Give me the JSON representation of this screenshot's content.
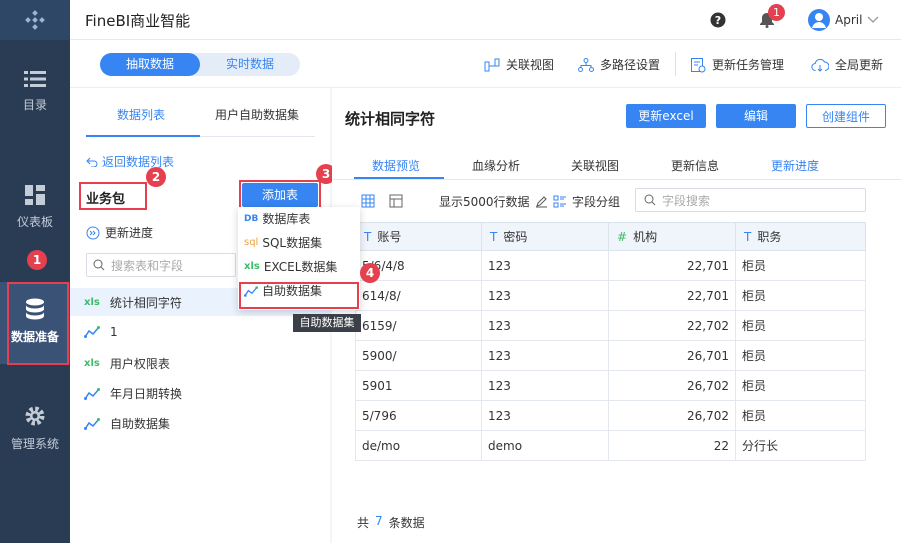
{
  "app": {
    "title": "FineBI商业智能",
    "user": "April",
    "notif_count": "1"
  },
  "sidebar": [
    {
      "label": "目录",
      "icon": "list-icon"
    },
    {
      "label": "仪表板",
      "icon": "dashboard-icon"
    },
    {
      "label": "数据准备",
      "icon": "database-icon"
    },
    {
      "label": "管理系统",
      "icon": "gear-icon"
    }
  ],
  "mode": {
    "extract": "抽取数据",
    "realtime": "实时数据"
  },
  "toolbar": {
    "relation": "关联视图",
    "multipath": "多路径设置",
    "task": "更新任务管理",
    "global": "全局更新"
  },
  "left": {
    "tab1": "数据列表",
    "tab2": "用户自助数据集",
    "back": "返回数据列表",
    "pkg": "业务包",
    "add": "添加表",
    "progress": "更新进度",
    "search_ph": "搜索表和字段",
    "items": [
      "统计相同字符",
      "1",
      "用户权限表",
      "年月日期转换",
      "自助数据集"
    ]
  },
  "menu": {
    "db": "数据库表",
    "sql": "SQL数据集",
    "excel": "EXCEL数据集",
    "self": "自助数据集",
    "tip": "自助数据集"
  },
  "right": {
    "title": "统计相同字符",
    "btn_excel": "更新excel",
    "btn_edit": "编辑",
    "btn_create": "创建组件",
    "tabs": [
      "数据预览",
      "血缘分析",
      "关联视图",
      "更新信息",
      "更新进度"
    ],
    "show_rows": "显示5000行数据",
    "group": "字段分组",
    "field_search": "字段搜索",
    "columns": [
      "账号",
      "密码",
      "机构",
      "职务"
    ],
    "rows": [
      [
        "5/6/4/8",
        "123",
        "22,701",
        "柜员"
      ],
      [
        "614/8/",
        "123",
        "22,701",
        "柜员"
      ],
      [
        "6159/",
        "123",
        "22,702",
        "柜员"
      ],
      [
        "5900/",
        "123",
        "26,701",
        "柜员"
      ],
      [
        "5901",
        "123",
        "26,702",
        "柜员"
      ],
      [
        "5/796",
        "123",
        "26,702",
        "柜员"
      ],
      [
        "de/mo",
        "demo",
        "22",
        "分行长"
      ]
    ],
    "total_prefix": "共",
    "total": "7",
    "total_suffix": "条数据"
  },
  "steps": [
    "1",
    "2",
    "3",
    "4"
  ]
}
